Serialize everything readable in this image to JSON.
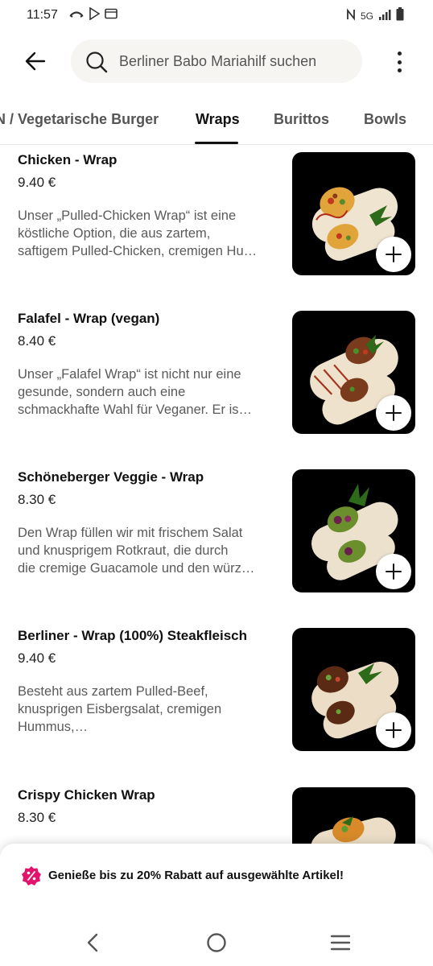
{
  "status_bar": {
    "time": "11:57",
    "network": "5G",
    "icons_left": [
      "missed-call-icon",
      "play-store-icon",
      "screen-icon"
    ],
    "icons_right": [
      "nfc-icon",
      "signal-icon",
      "battery-icon"
    ]
  },
  "header": {
    "search_placeholder": "Berliner Babo Mariahilf suchen"
  },
  "tabs": [
    {
      "label": "N / Vegetarische Burger",
      "active": false
    },
    {
      "label": "Wraps",
      "active": true
    },
    {
      "label": "Burittos",
      "active": false
    },
    {
      "label": "Bowls",
      "active": false
    }
  ],
  "items": [
    {
      "name": "Chicken - Wrap",
      "price": "9.40 €",
      "desc": [
        "Unser „Pulled-Chicken Wrap“ ist eine",
        "köstliche Option, die aus zartem,",
        "saftigem Pulled-Chicken, cremigen Hu…"
      ]
    },
    {
      "name": "Falafel - Wrap (vegan)",
      "price": "8.40 €",
      "desc": [
        "Unser „Falafel Wrap“ ist nicht nur eine",
        "gesunde, sondern auch eine",
        "schmackhafte Wahl für Veganer. Er is…"
      ]
    },
    {
      "name": "Schöneberger Veggie - Wrap",
      "price": "8.30 €",
      "desc": [
        "Den Wrap füllen wir mit frischem Salat",
        "und knusprigem Rotkraut, die durch",
        "die cremige Guacamole und den würz…"
      ]
    },
    {
      "name": "Berliner - Wrap (100%) Steakfleisch",
      "price": "9.40 €",
      "desc": [
        "Besteht aus zartem Pulled-Beef,",
        "knusprigen Eisbergsalat, cremigen",
        "Hummus,…"
      ]
    },
    {
      "name": "Crispy Chicken Wrap",
      "price": "8.30 €",
      "desc": []
    }
  ],
  "promo": {
    "text": "Genieße bis zu 20% Rabatt auf ausgewählte Artikel!",
    "accent": "#e3126b"
  },
  "navbar": {
    "buttons": [
      "back-icon",
      "home-icon",
      "recents-icon"
    ]
  }
}
